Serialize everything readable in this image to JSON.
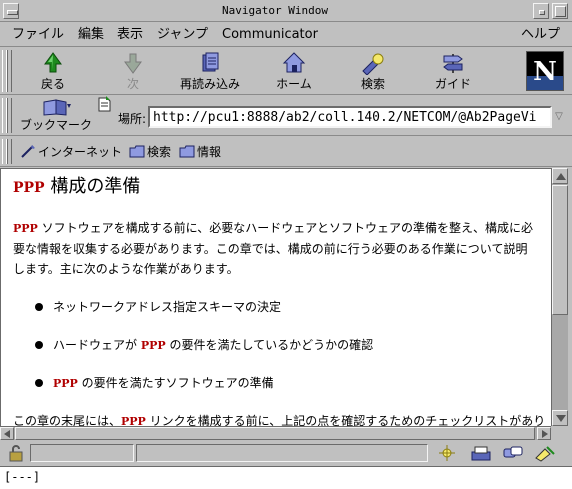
{
  "window": {
    "title": "Navigator Window"
  },
  "menubar": {
    "file": "ファイル",
    "edit": "編集",
    "view": "表示",
    "jump": "ジャンプ",
    "communicator": "Communicator",
    "help": "ヘルプ"
  },
  "navbar": {
    "back": "戻る",
    "forward": "次",
    "reload": "再読み込み",
    "home": "ホーム",
    "search": "検索",
    "guide": "ガイド"
  },
  "locbar": {
    "bookmarks": "ブックマーク",
    "location_label": "場所:",
    "url": "http://pcu1:8888/ab2/coll.140.2/NETCOM/@Ab2PageVi"
  },
  "personal_toolbar": {
    "internet": "インターネット",
    "search": "検索",
    "info": "情報"
  },
  "page": {
    "heading_ppp": "PPP",
    "heading_rest": " 構成の準備",
    "intro_ppp": "PPP",
    "intro_rest": " ソフトウェアを構成する前に、必要なハードウェアとソフトウェアの準備を整え、構成に必要な情報を収集する必要があります。この章では、構成の前に行う必要のある作業について説明します。主に次のような作業があります。",
    "bullet1": "ネットワークアドレス指定スキーマの決定",
    "bullet2_pre": "ハードウェアが ",
    "bullet2_ppp": "PPP",
    "bullet2_post": " の要件を満たしているかどうかの確認",
    "bullet3_ppp": "PPP",
    "bullet3_post": " の要件を満たすソフトウェアの準備",
    "closing_pre": "この章の末尾には、",
    "closing_ppp": "PPP",
    "closing_post": " リンクを構成する前に、上記の点を確認するためのチェックリストがあり"
  },
  "status": {
    "text": "",
    "cmdline": "[---]"
  },
  "colors": {
    "ppp": "#b00000",
    "chrome": "#c0c0c0"
  }
}
